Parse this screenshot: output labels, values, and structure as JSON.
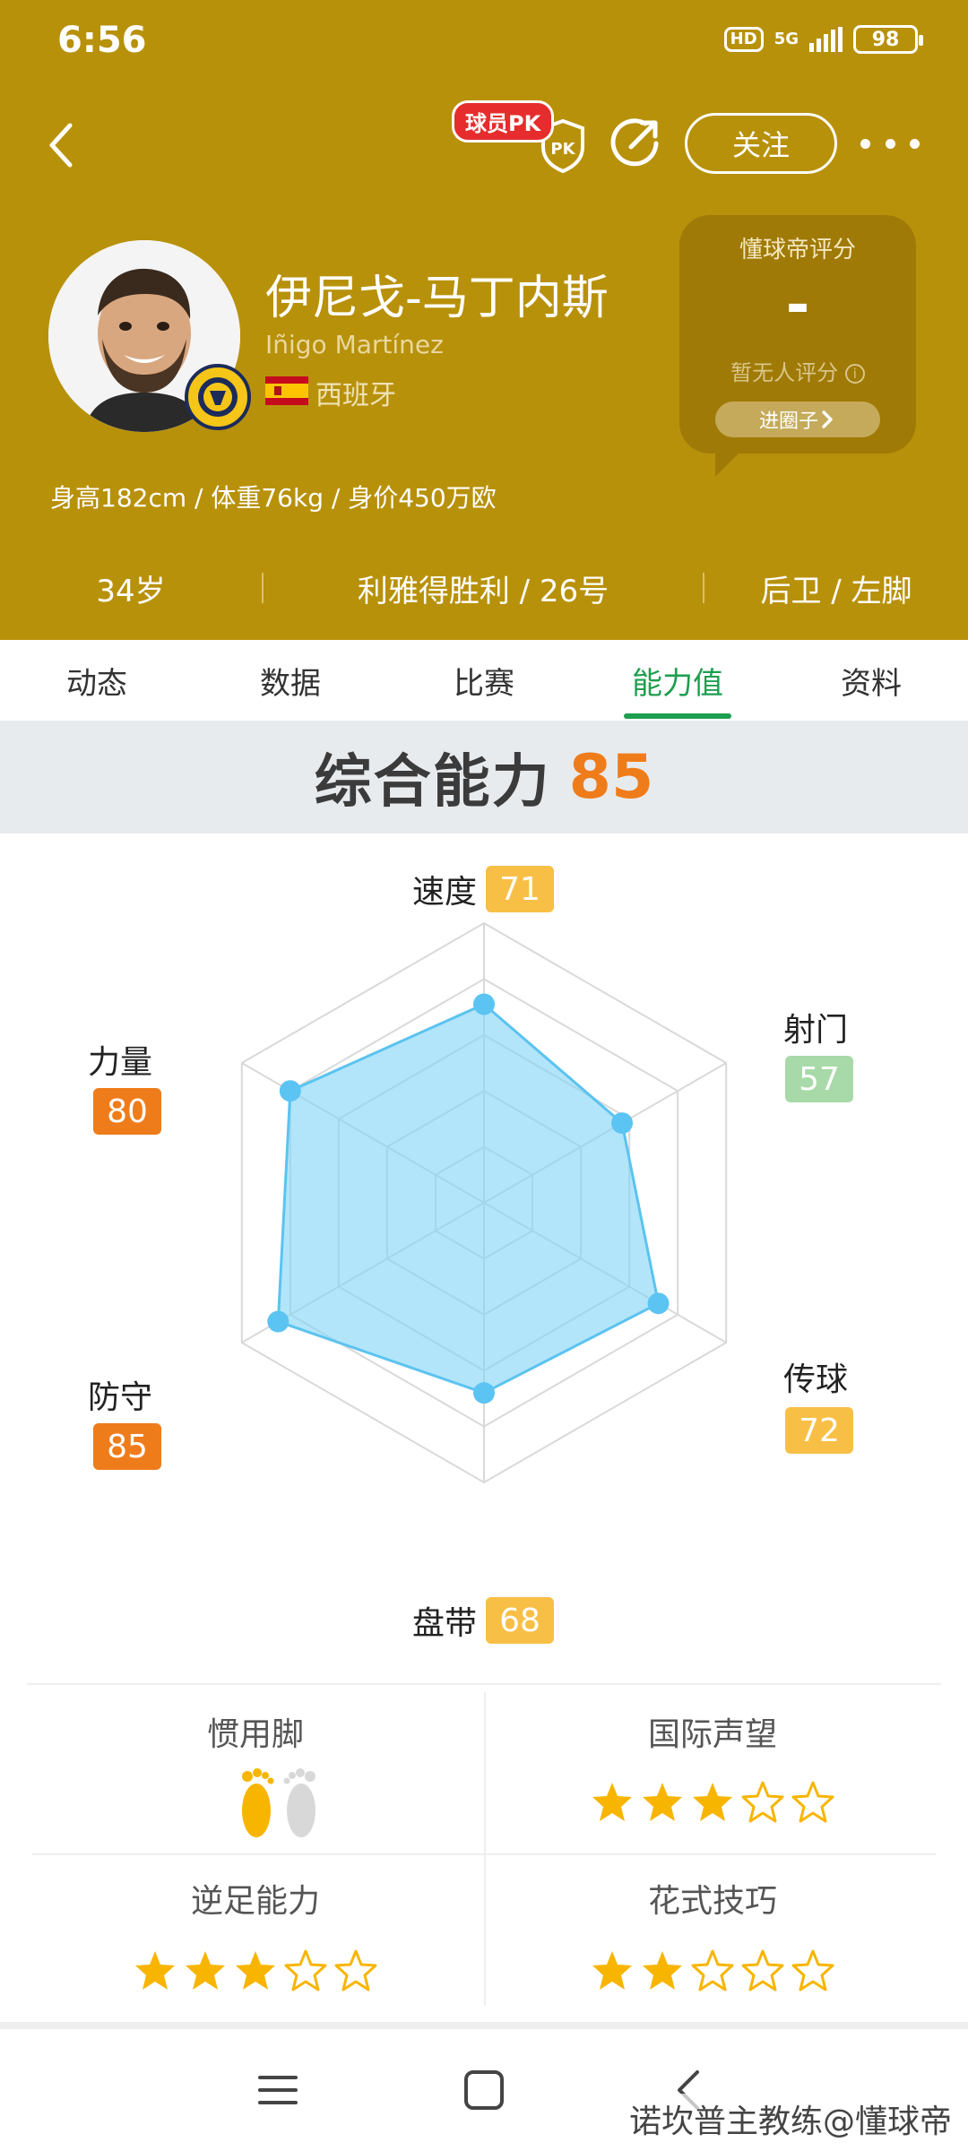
{
  "status_bar": {
    "time": "6:56",
    "hd_label": "HD",
    "network": "5G",
    "battery": "98"
  },
  "nav": {
    "pk_tag": "球员PK",
    "pk_shield_text": "PK",
    "follow_label": "关注"
  },
  "player": {
    "name_cn": "伊尼戈-马丁内斯",
    "name_en": "Iñigo Martínez",
    "country": "西班牙",
    "body_stats": "身高182cm / 体重76kg / 身价450万欧",
    "age": "34岁",
    "club_number": "利雅得胜利 / 26号",
    "position_foot": "后卫 / 左脚"
  },
  "rating_card": {
    "title": "懂球帝评分",
    "value": "-",
    "subtitle": "暂无人评分",
    "info_glyph": "i",
    "button_label": "进圈子"
  },
  "tabs": [
    {
      "label": "动态"
    },
    {
      "label": "数据"
    },
    {
      "label": "比赛"
    },
    {
      "label": "能力值"
    },
    {
      "label": "资料"
    }
  ],
  "active_tab_index": 3,
  "overall": {
    "label": "综合能力",
    "value": "85"
  },
  "attributes": [
    {
      "key": "speed",
      "label": "速度",
      "value": 71,
      "color": "#f8bf46"
    },
    {
      "key": "shooting",
      "label": "射门",
      "value": 57,
      "color": "#a8d9a8"
    },
    {
      "key": "passing",
      "label": "传球",
      "value": 72,
      "color": "#f8bf46"
    },
    {
      "key": "dribbling",
      "label": "盘带",
      "value": 68,
      "color": "#f8bf46"
    },
    {
      "key": "defending",
      "label": "防守",
      "value": 85,
      "color": "#ef7c1a"
    },
    {
      "key": "physical",
      "label": "力量",
      "value": 80,
      "color": "#ef7c1a"
    }
  ],
  "radar_colors": {
    "fill": "#7fd3f7",
    "stroke": "#5bc3f0",
    "point": "#5cc4f2",
    "grid": "#d9d9d9"
  },
  "skills": {
    "preferred_foot": {
      "title": "惯用脚",
      "value": "左脚"
    },
    "reputation": {
      "title": "国际声望",
      "stars": 3,
      "max": 5
    },
    "weak_foot": {
      "title": "逆足能力",
      "stars": 3,
      "max": 5
    },
    "skill_moves": {
      "title": "花式技巧",
      "stars": 2,
      "max": 5
    }
  },
  "colors": {
    "header": "#b8910b",
    "accent_green": "#1e9e4f",
    "orange": "#ef7c1a",
    "star": "#f8b500"
  },
  "watermark": "诺坎普主教练@懂球帝"
}
